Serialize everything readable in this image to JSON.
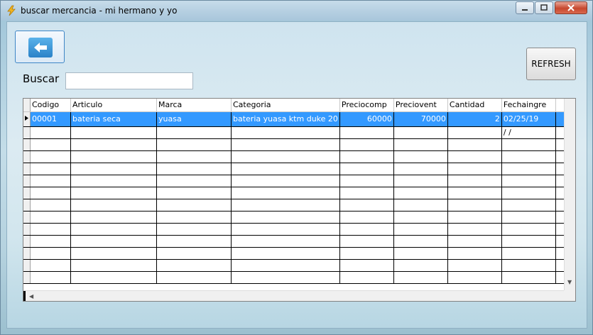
{
  "window": {
    "title": "buscar mercancia - mi hermano y yo"
  },
  "search": {
    "label": "Buscar",
    "value": ""
  },
  "buttons": {
    "refresh_label": "REFRESH"
  },
  "grid": {
    "columns": [
      "Codigo",
      "Articulo",
      "Marca",
      "Categoria",
      "Preciocomp",
      "Preciovent",
      "Cantidad",
      "Fechaingre"
    ],
    "rows": [
      {
        "codigo": "00001",
        "articulo": "bateria seca",
        "marca": "yuasa",
        "categoria": "bateria yuasa ktm duke 20",
        "preciocomp": "60000",
        "preciovent": "70000",
        "cantidad": "2",
        "fechaingre": "02/25/19",
        "selected": true
      },
      {
        "codigo": "",
        "articulo": "",
        "marca": "",
        "categoria": "",
        "preciocomp": "",
        "preciovent": "",
        "cantidad": "",
        "fechaingre": "/ /",
        "selected": false
      }
    ],
    "empty_rows": 12
  },
  "icons": {
    "app": "lightning-icon",
    "back": "back-arrow-icon",
    "minimize": "minimize-icon",
    "maximize": "maximize-icon",
    "close": "close-icon",
    "row_pointer": "row-pointer-icon"
  }
}
